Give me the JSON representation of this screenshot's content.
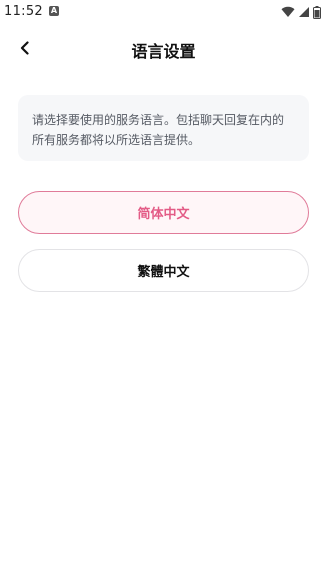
{
  "status_bar": {
    "time": "11:52",
    "notification_badge": "A",
    "icons": [
      "wifi-icon",
      "signal-icon",
      "battery-icon"
    ]
  },
  "header": {
    "back_icon": "chevron-left-icon",
    "title": "语言设置"
  },
  "info": {
    "text": "请选择要使用的服务语言。包括聊天回复在内的所有服务都将以所选语言提供。"
  },
  "languages": [
    {
      "label": "简体中文",
      "selected": true
    },
    {
      "label": "繁體中文",
      "selected": false
    }
  ],
  "colors": {
    "accent": "#e35b86",
    "selected_border": "#e07b99",
    "selected_bg": "#fff6f8",
    "card_bg": "#f6f7f9"
  }
}
